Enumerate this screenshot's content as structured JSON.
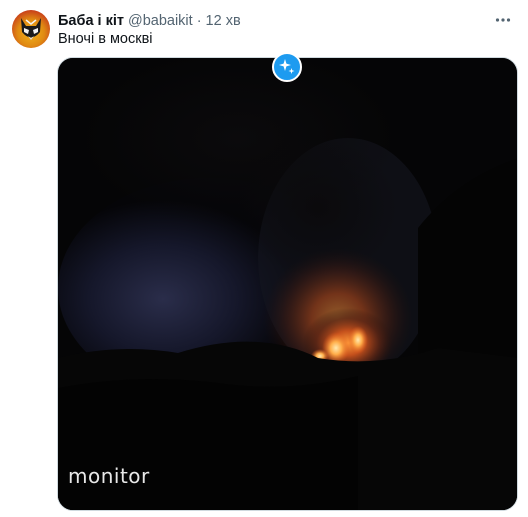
{
  "tweet": {
    "display_name": "Баба і кіт",
    "handle": "@babaikit",
    "separator": "·",
    "time": "12 хв",
    "text": "Вночі в москві"
  },
  "media": {
    "watermark": "monitor",
    "type": "video"
  },
  "icons": {
    "more": "more-options-icon",
    "badge": "sparkle-icon",
    "avatar": "cat-mask-avatar"
  },
  "colors": {
    "text_primary": "#0f1419",
    "text_secondary": "#536471",
    "accent": "#1d9bf0"
  }
}
